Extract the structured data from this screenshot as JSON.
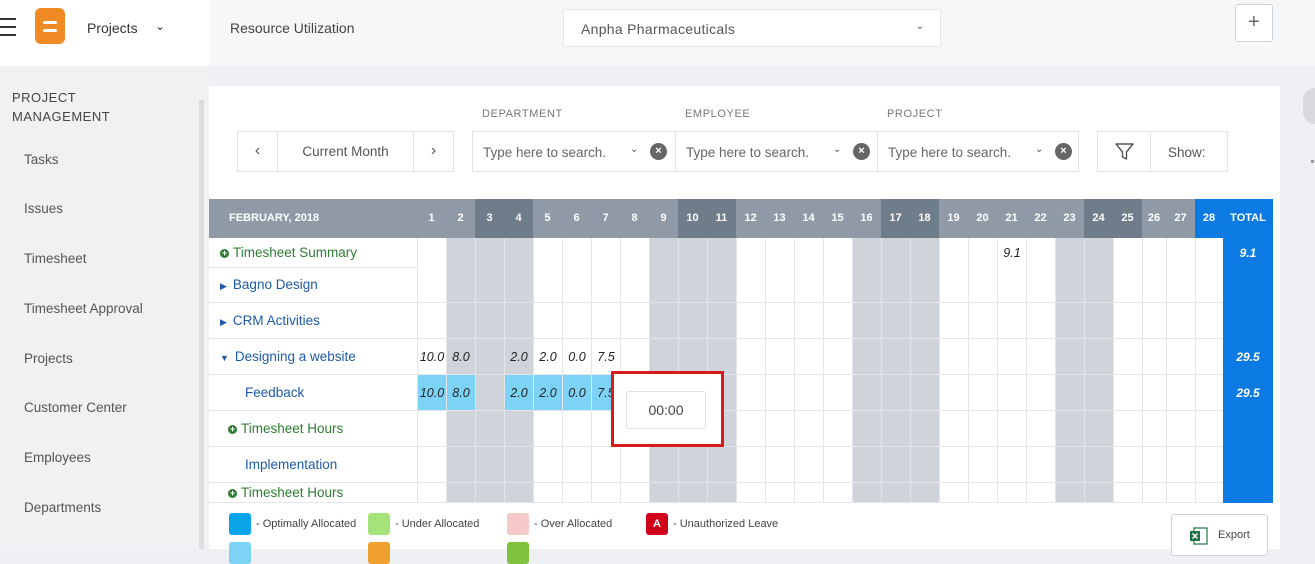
{
  "topbar": {
    "module_label": "Projects",
    "page_heading": "Resource Utilization",
    "company_value": "Anpha Pharmaceuticals",
    "add_label": "+"
  },
  "sidebar": {
    "heading_line1": "PROJECT",
    "heading_line2": "MANAGEMENT",
    "items": [
      "Tasks",
      "Issues",
      "Timesheet",
      "Timesheet Approval",
      "Projects",
      "Customer Center",
      "Employees",
      "Departments"
    ]
  },
  "filters": {
    "month_label": "Current Month",
    "department_label": "DEPARTMENT",
    "employee_label": "EMPLOYEE",
    "project_label": "PROJECT",
    "department_placeholder": "Type here to search.",
    "employee_placeholder": "Type here to search.",
    "project_placeholder": "Type here to search.",
    "show_label": "Show:"
  },
  "grid": {
    "month_header": "FEBRUARY, 2018",
    "total_header": "TOTAL",
    "days": [
      "1",
      "2",
      "3",
      "4",
      "5",
      "6",
      "7",
      "8",
      "9",
      "10",
      "11",
      "12",
      "13",
      "14",
      "15",
      "16",
      "17",
      "18",
      "19",
      "20",
      "21",
      "22",
      "23",
      "24",
      "25",
      "26",
      "27",
      "28"
    ],
    "rows": [
      {
        "label": "Timesheet Summary",
        "kind": "summary",
        "values": {
          "21": "9.1"
        },
        "total": "9.1"
      },
      {
        "label": "Bagno Design",
        "kind": "project",
        "values": {},
        "total": ""
      },
      {
        "label": "CRM Activities",
        "kind": "project",
        "values": {},
        "total": ""
      },
      {
        "label": "Designing a website",
        "kind": "project-open",
        "values": {
          "1": "10.0",
          "2": "8.0",
          "4": "2.0",
          "5": "2.0",
          "6": "0.0",
          "7": "7.5"
        },
        "total": "29.5"
      },
      {
        "label": "Feedback",
        "kind": "task",
        "values": {
          "1": "10.0",
          "2": "8.0",
          "4": "2.0",
          "5": "2.0",
          "6": "0.0",
          "7": "7.5"
        },
        "total": "29.5"
      },
      {
        "label": "Timesheet Hours",
        "kind": "summary",
        "values": {},
        "total": ""
      },
      {
        "label": "Implementation",
        "kind": "task",
        "values": {},
        "total": ""
      },
      {
        "label": "Timesheet Hours",
        "kind": "summary",
        "values": {},
        "total": ""
      }
    ]
  },
  "popup": {
    "time_value": "00:00"
  },
  "legend": {
    "items": [
      {
        "label": "- Optimally Allocated",
        "color": "#0aa5e8"
      },
      {
        "label": "- Under Allocated",
        "color": "#a6e27a"
      },
      {
        "label": "- Over Allocated",
        "color": "#f6c9c9"
      },
      {
        "label": "- Unauthorized Leave",
        "color": "#d0021b",
        "glyph": "A"
      }
    ],
    "export_label": "Export"
  },
  "colors": {
    "header_gray": "#8f9aa6",
    "header_dark": "#6f7c89",
    "weekend_dark": "#8a94a0",
    "today_blue": "#0b7be3",
    "weekend_fill": "#cfd4da",
    "weekday_alt": "#eef0f3",
    "text_green": "#2e7d32",
    "text_blue": "#1e5aa8",
    "highlight": "#7dd3f5"
  }
}
